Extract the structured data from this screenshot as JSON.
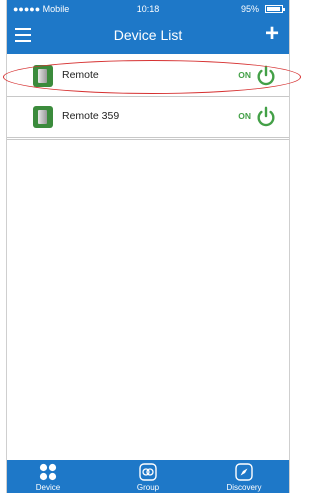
{
  "status_bar": {
    "carrier": "●●●●● Mobile",
    "time": "10:18",
    "battery_text": "95%",
    "battery_level": 0.95
  },
  "header": {
    "menu_icon": "hamburger-icon",
    "title": "Device List",
    "add_icon": "plus-icon"
  },
  "devices": [
    {
      "name": "Remote",
      "state": "ON",
      "icon": "remote-device-icon"
    },
    {
      "name": "Remote 359",
      "state": "ON",
      "icon": "remote-device-icon"
    }
  ],
  "tabs": [
    {
      "label": "Device",
      "icon": "grid-icon"
    },
    {
      "label": "Group",
      "icon": "group-icon"
    },
    {
      "label": "Discovery",
      "icon": "compass-icon"
    }
  ],
  "colors": {
    "brand": "#1e78c8",
    "on_green": "#43a047",
    "highlight": "#d63131"
  }
}
